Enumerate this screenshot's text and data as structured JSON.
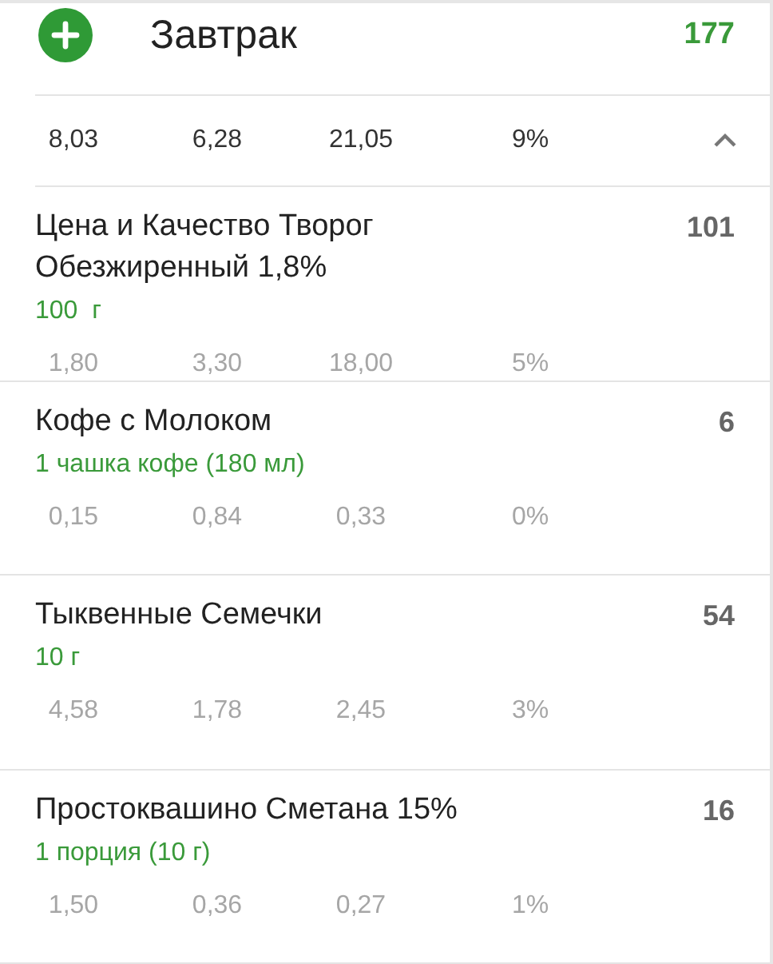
{
  "meal": {
    "title": "Завтрак",
    "calories": "177"
  },
  "summary": {
    "values": [
      "8,03",
      "6,28",
      "21,05",
      "9%"
    ],
    "expanded": true
  },
  "items": [
    {
      "name": "Цена и Качество Творог Обезжиренный 1,8%",
      "calories": "101",
      "amount": "100  г",
      "values": [
        "1,80",
        "3,30",
        "18,00",
        "5%"
      ]
    },
    {
      "name": "Кофе с Молоком",
      "calories": "6",
      "amount": "1 чашка кофе (180 мл)",
      "values": [
        "0,15",
        "0,84",
        "0,33",
        "0%"
      ]
    },
    {
      "name": "Тыквенные Семечки",
      "calories": "54",
      "amount": "10 г",
      "values": [
        "4,58",
        "1,78",
        "2,45",
        "3%"
      ]
    },
    {
      "name": "Простоквашино Сметана 15%",
      "calories": "16",
      "amount": "1 порция (10 г)",
      "values": [
        "1,50",
        "0,36",
        "0,27",
        "1%"
      ]
    }
  ]
}
